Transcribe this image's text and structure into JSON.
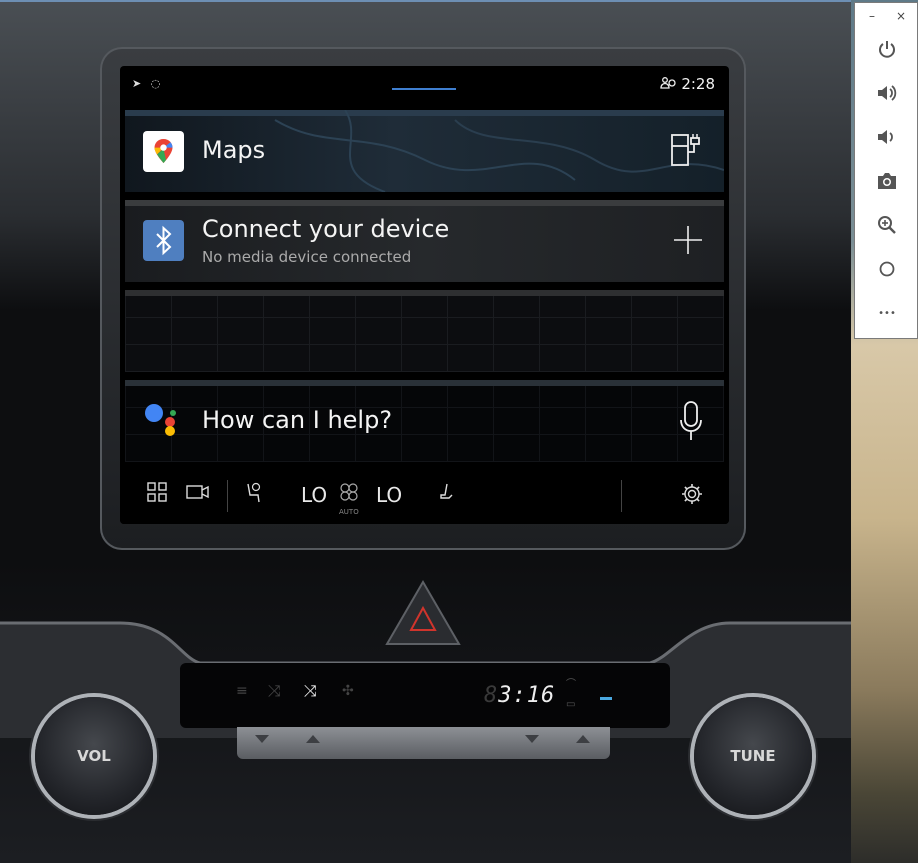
{
  "status_bar": {
    "left_icons": "➤ ◌",
    "time": "2:28",
    "user_icon": "person-icon"
  },
  "cards": {
    "maps": {
      "title": "Maps",
      "app_icon": "google-maps-icon",
      "action_icon": "ev-charging-icon"
    },
    "media": {
      "title": "Connect your device",
      "subtitle": "No media device connected",
      "app_icon": "bluetooth-icon",
      "action_icon": "add-icon"
    },
    "assistant": {
      "title": "How can I help?",
      "app_icon": "google-assistant-icon",
      "action_icon": "microphone-icon"
    }
  },
  "dock": {
    "temp_left": "LO",
    "temp_right": "LO",
    "fan_mode": "AUTO"
  },
  "console": {
    "display_dim": "8",
    "display_digits": "3:16",
    "vol_label": "VOL",
    "tune_label": "TUNE"
  },
  "toolbar": {
    "minimize": "–",
    "close": "×",
    "more": "•••"
  },
  "colors": {
    "accent_blue": "#3f7fd0",
    "bluetooth_blue": "#4f7fc0",
    "hazard_red": "#d0342c"
  }
}
